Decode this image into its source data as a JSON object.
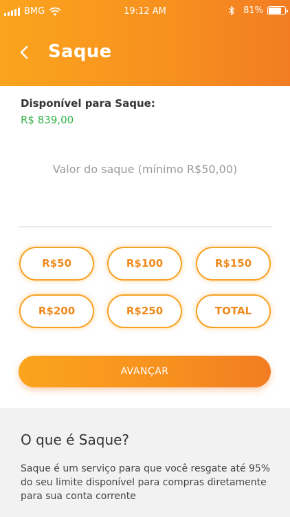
{
  "status_bar": {
    "carrier": "BMG",
    "time": "19:12 AM",
    "battery": "81%",
    "battery_level": 0.81
  },
  "header": {
    "title": "Saque"
  },
  "available": {
    "label": "Disponível para Saque:",
    "value": "R$ 839,00"
  },
  "amount_field": {
    "placeholder": "Valor do saque (mínimo R$50,00)",
    "value": ""
  },
  "quick_amounts": [
    "R$50",
    "R$100",
    "R$150",
    "R$200",
    "R$250",
    "TOTAL"
  ],
  "advance_button": "AVANÇAR",
  "info": {
    "title": "O que é Saque?",
    "text": "Saque é um serviço para que você resgate até 95% do seu limite disponível para compras diretamente para sua conta corrente"
  },
  "colors": {
    "brand_orange": "#f7901f",
    "available_green": "#35b24a"
  }
}
